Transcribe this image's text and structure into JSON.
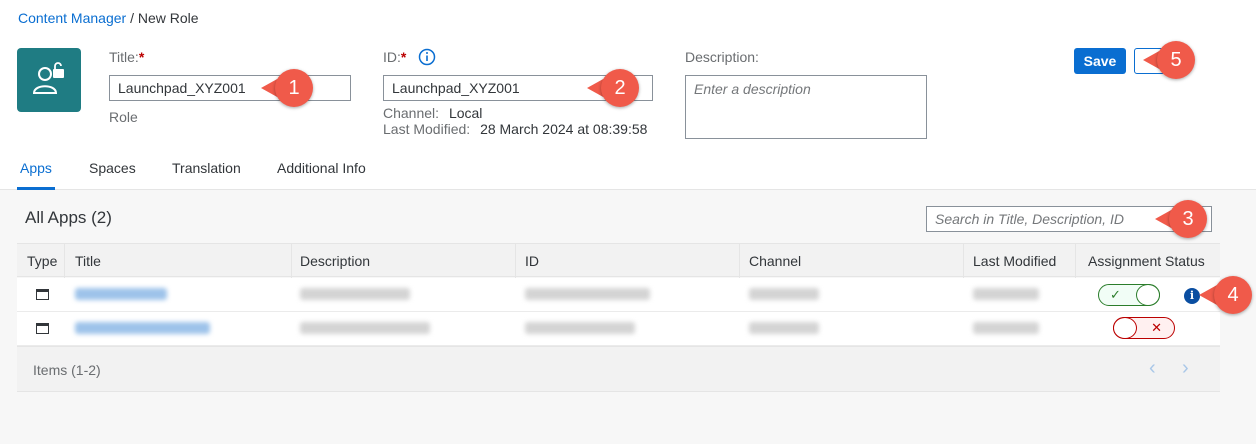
{
  "breadcrumb": {
    "link": "Content Manager",
    "separator": "/",
    "current": "New Role"
  },
  "header": {
    "icon": "user-lock-icon",
    "title_label": "Title:",
    "title_value": "Launchpad_XYZ001",
    "role_type": "Role",
    "id_label": "ID:",
    "id_value": "Launchpad_XYZ001",
    "channel_label": "Channel:",
    "channel_value": "Local",
    "last_modified_label": "Last Modified:",
    "last_modified_value": "28 March 2024 at 08:39:58",
    "description_label": "Description:",
    "description_placeholder": "Enter a description",
    "required_mark": "*",
    "save_label": "Save"
  },
  "tabs": [
    {
      "label": "Apps",
      "active": true
    },
    {
      "label": "Spaces",
      "active": false
    },
    {
      "label": "Translation",
      "active": false
    },
    {
      "label": "Additional Info",
      "active": false
    }
  ],
  "apps": {
    "title": "All Apps (2)",
    "search_placeholder": "Search in Title, Description, ID",
    "columns": [
      "Type",
      "Title",
      "Description",
      "ID",
      "Channel",
      "Last Modified",
      "Assignment Status"
    ],
    "rows": [
      {
        "type_icon": "app-window-icon",
        "assigned": true
      },
      {
        "type_icon": "app-window-icon",
        "assigned": false
      }
    ],
    "footer": "Items (1-2)"
  },
  "callouts": [
    "1",
    "2",
    "3",
    "4",
    "5"
  ],
  "colors": {
    "accent": "#0a6ed1",
    "tile": "#1f7c83",
    "callout": "#f05a4a",
    "on": "#2b7d2b",
    "off": "#bb0000"
  }
}
